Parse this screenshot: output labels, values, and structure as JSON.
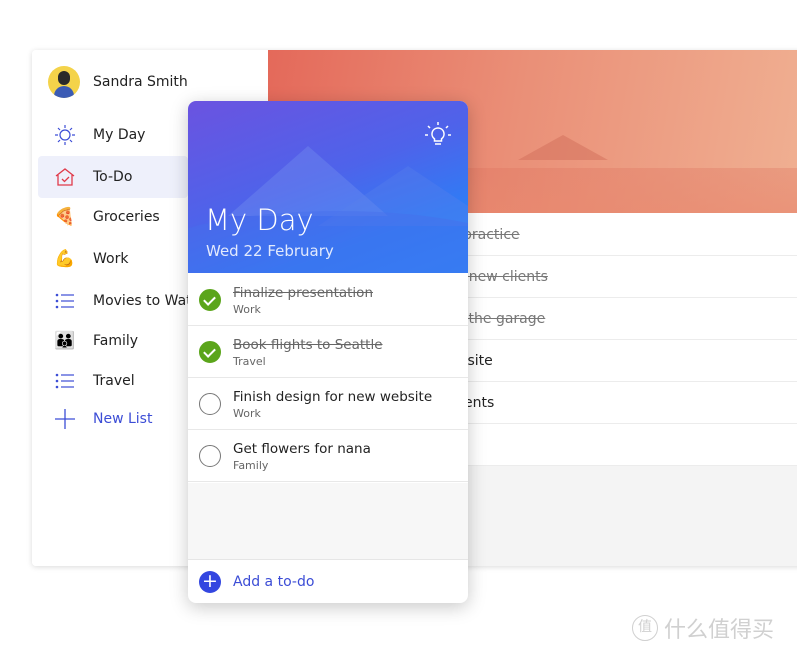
{
  "sidebar": {
    "user_name": "Sandra Smith",
    "items": [
      {
        "label": "My Day",
        "icon": "sun-icon"
      },
      {
        "label": "To-Do",
        "icon": "home-check-icon",
        "active": true
      },
      {
        "label": "Groceries",
        "icon": "pizza-icon"
      },
      {
        "label": "Work",
        "icon": "flexed-biceps-icon"
      },
      {
        "label": "Movies to Watch",
        "icon": "list-icon"
      },
      {
        "label": "Family",
        "icon": "family-icon"
      },
      {
        "label": "Travel",
        "icon": "list-icon"
      }
    ],
    "new_list": "New List"
  },
  "background_list": {
    "rows": [
      {
        "text": "o practice",
        "done": true
      },
      {
        "text": "or new clients",
        "done": true
      },
      {
        "text": "at the garage",
        "done": true
      },
      {
        "text": "ebsite",
        "done": false
      },
      {
        "text": "arents",
        "done": false
      },
      {
        "text": "",
        "done": false
      }
    ]
  },
  "my_day": {
    "title": "My Day",
    "date": "Wed 22 February",
    "tasks": [
      {
        "title": "Finalize presentation",
        "list": "Work",
        "done": true
      },
      {
        "title": "Book flights to Seattle",
        "list": "Travel",
        "done": true
      },
      {
        "title": "Finish design for new website",
        "list": "Work",
        "done": false
      },
      {
        "title": "Get flowers for nana",
        "list": "Family",
        "done": false
      }
    ],
    "add_label": "Add a to-do"
  },
  "watermark": {
    "seal": "值",
    "text": "什么值得买"
  },
  "colors": {
    "accent": "#3c4dd6",
    "check": "#5ba51b",
    "active_bg": "#eef0fb"
  }
}
